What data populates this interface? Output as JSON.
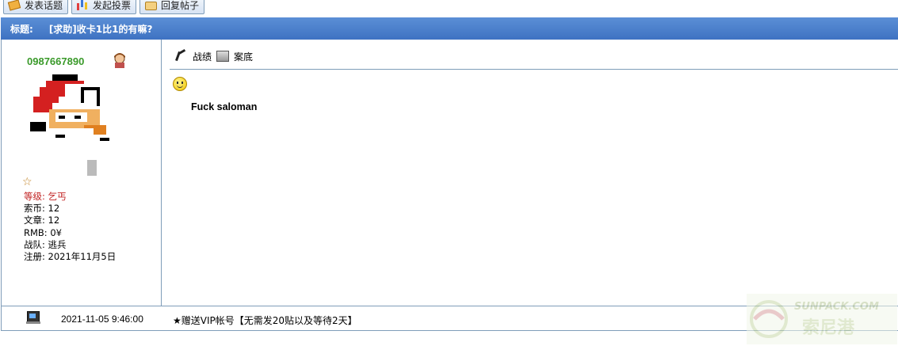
{
  "toolbar": {
    "new_topic": "发表话题",
    "new_poll": "发起投票",
    "reply": "回复帖子"
  },
  "title_bar": {
    "label": "标题:",
    "title": "[求助]收卡1比1的有嘛?"
  },
  "author": {
    "username": "0987667890",
    "level_label": "等级:",
    "level_value": "乞丐",
    "coins_label": "索币:",
    "coins_value": "12",
    "articles_label": "文章:",
    "articles_value": "12",
    "rmb_label": "RMB:",
    "rmb_value": "0¥",
    "team_label": "战队:",
    "team_value": "逃兵",
    "registered_label": "注册:",
    "registered_value": "2021年11月5日"
  },
  "actions": {
    "record": "战绩",
    "file": "案底"
  },
  "post": {
    "body": "Fuck saloman",
    "time": "2021-11-05 9:46:00",
    "vip_link": "★赠送VIP帐号【无需发20贴以及等待2天】"
  },
  "watermark": {
    "line1": "SUNPACK.COM",
    "line2": "索尼港"
  },
  "colors": {
    "title_bar": "#4a80cc",
    "border": "#7f9db9",
    "username": "#3a9a2a",
    "level": "#c02020"
  }
}
